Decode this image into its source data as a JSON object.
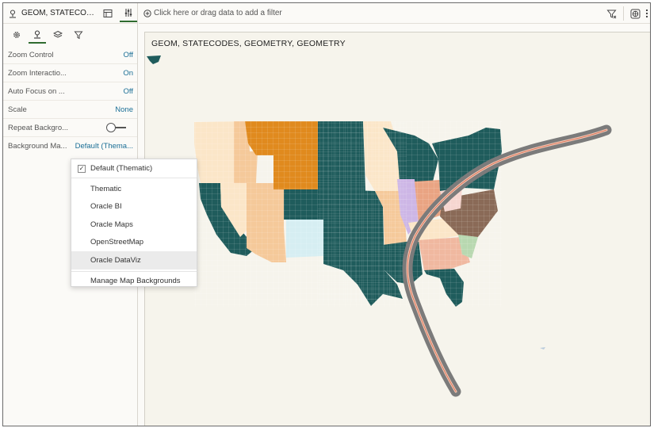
{
  "panel": {
    "title": "GEOM, STATECODE...",
    "props": [
      {
        "label": "Zoom Control",
        "value": "Off"
      },
      {
        "label": "Zoom Interactio...",
        "value": "On"
      },
      {
        "label": "Auto Focus on ...",
        "value": "Off"
      },
      {
        "label": "Scale",
        "value": "None"
      },
      {
        "label": "Repeat Backgro...",
        "value": ""
      },
      {
        "label": "Background Ma...",
        "value": "Default (Thema..."
      }
    ]
  },
  "dropdown": {
    "items": [
      {
        "label": "Default (Thematic)"
      },
      {
        "label": "Thematic"
      },
      {
        "label": "Oracle BI"
      },
      {
        "label": "Oracle Maps"
      },
      {
        "label": "OpenStreetMap"
      },
      {
        "label": "Oracle DataViz"
      },
      {
        "label": "Manage Map Backgrounds"
      }
    ]
  },
  "filter": {
    "placeholder": "Click here or drag data to add a filter"
  },
  "canvas": {
    "title": "GEOM, STATECODES, GEOMETRY, GEOMETRY"
  },
  "colors": {
    "teal": "#1f5c5c",
    "orange": "#e08a1e",
    "peach": "#f5c99a",
    "cream": "#fbe6c8",
    "lavender": "#cdb6e6",
    "brown": "#8a6a57",
    "lightblue": "#d6eef2",
    "pink": "#f0b8a0",
    "green": "#b8d8b0",
    "route": "#7b7b7b"
  },
  "icons": [
    "map-pin-icon",
    "table-icon",
    "sliders-icon",
    "gear-icon",
    "layers-icon",
    "filter-icon",
    "filter-clear-icon",
    "globe-icon",
    "more-icon"
  ]
}
